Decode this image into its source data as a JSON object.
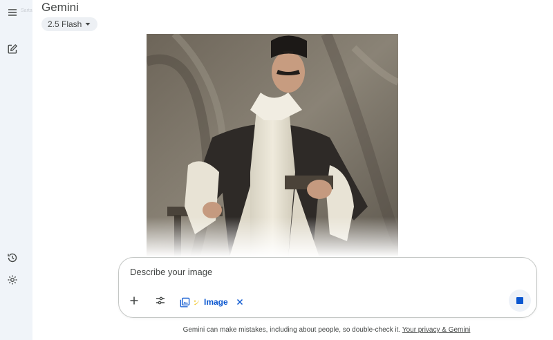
{
  "rail": {
    "watermark": "Sarta",
    "icons": {
      "menu": "menu-icon",
      "new_chat": "edit-square-icon",
      "activity": "history-icon",
      "settings": "gear-icon"
    }
  },
  "header": {
    "app_title": "Gemini",
    "model_selector": "2.5 Flash"
  },
  "image": {
    "description_icon": "generated-portrait-image"
  },
  "prompt": {
    "placeholder": "Describe your image",
    "tools": {
      "add": "plus-icon",
      "tools": "sliders-icon",
      "image_tool_icon": "image-library-icon",
      "image_tool_label": "Image",
      "remove_tool": "close-icon"
    },
    "stop": "stop-icon"
  },
  "footer": {
    "disclaimer": "Gemini can make mistakes, including about people, so double-check it.",
    "privacy_link": "Your privacy & Gemini"
  },
  "colors": {
    "rail_bg": "#f0f4f9",
    "accent": "#0b57d0",
    "text_secondary": "#444746"
  }
}
